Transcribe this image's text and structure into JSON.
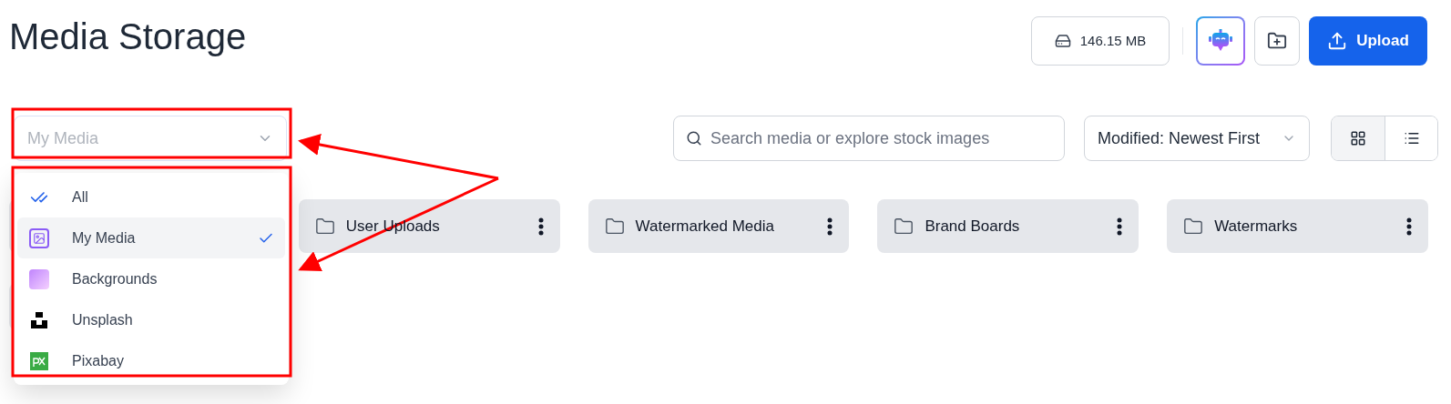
{
  "title": "Media Storage",
  "header_actions": {
    "storage": "146.15 MB",
    "upload": "Upload"
  },
  "source_select": {
    "value": "My Media",
    "expanded": true,
    "options": [
      {
        "label": "All",
        "kind": "all",
        "selected": false
      },
      {
        "label": "My Media",
        "kind": "my-media",
        "selected": true
      },
      {
        "label": "Backgrounds",
        "kind": "backgrounds",
        "selected": false
      },
      {
        "label": "Unsplash",
        "kind": "unsplash",
        "selected": false
      },
      {
        "label": "Pixabay",
        "kind": "pixabay",
        "selected": false
      }
    ]
  },
  "search": {
    "placeholder": "Search media or explore stock images"
  },
  "sort": {
    "value": "Modified: Newest First"
  },
  "view_toggle": [
    {
      "kind": "grid",
      "selected": true
    },
    {
      "kind": "list",
      "selected": false
    }
  ],
  "folders": [
    {
      "name": "User Uploads"
    },
    {
      "name": "Watermarked Media"
    },
    {
      "name": "Brand Boards"
    },
    {
      "name": "Watermarks"
    }
  ]
}
